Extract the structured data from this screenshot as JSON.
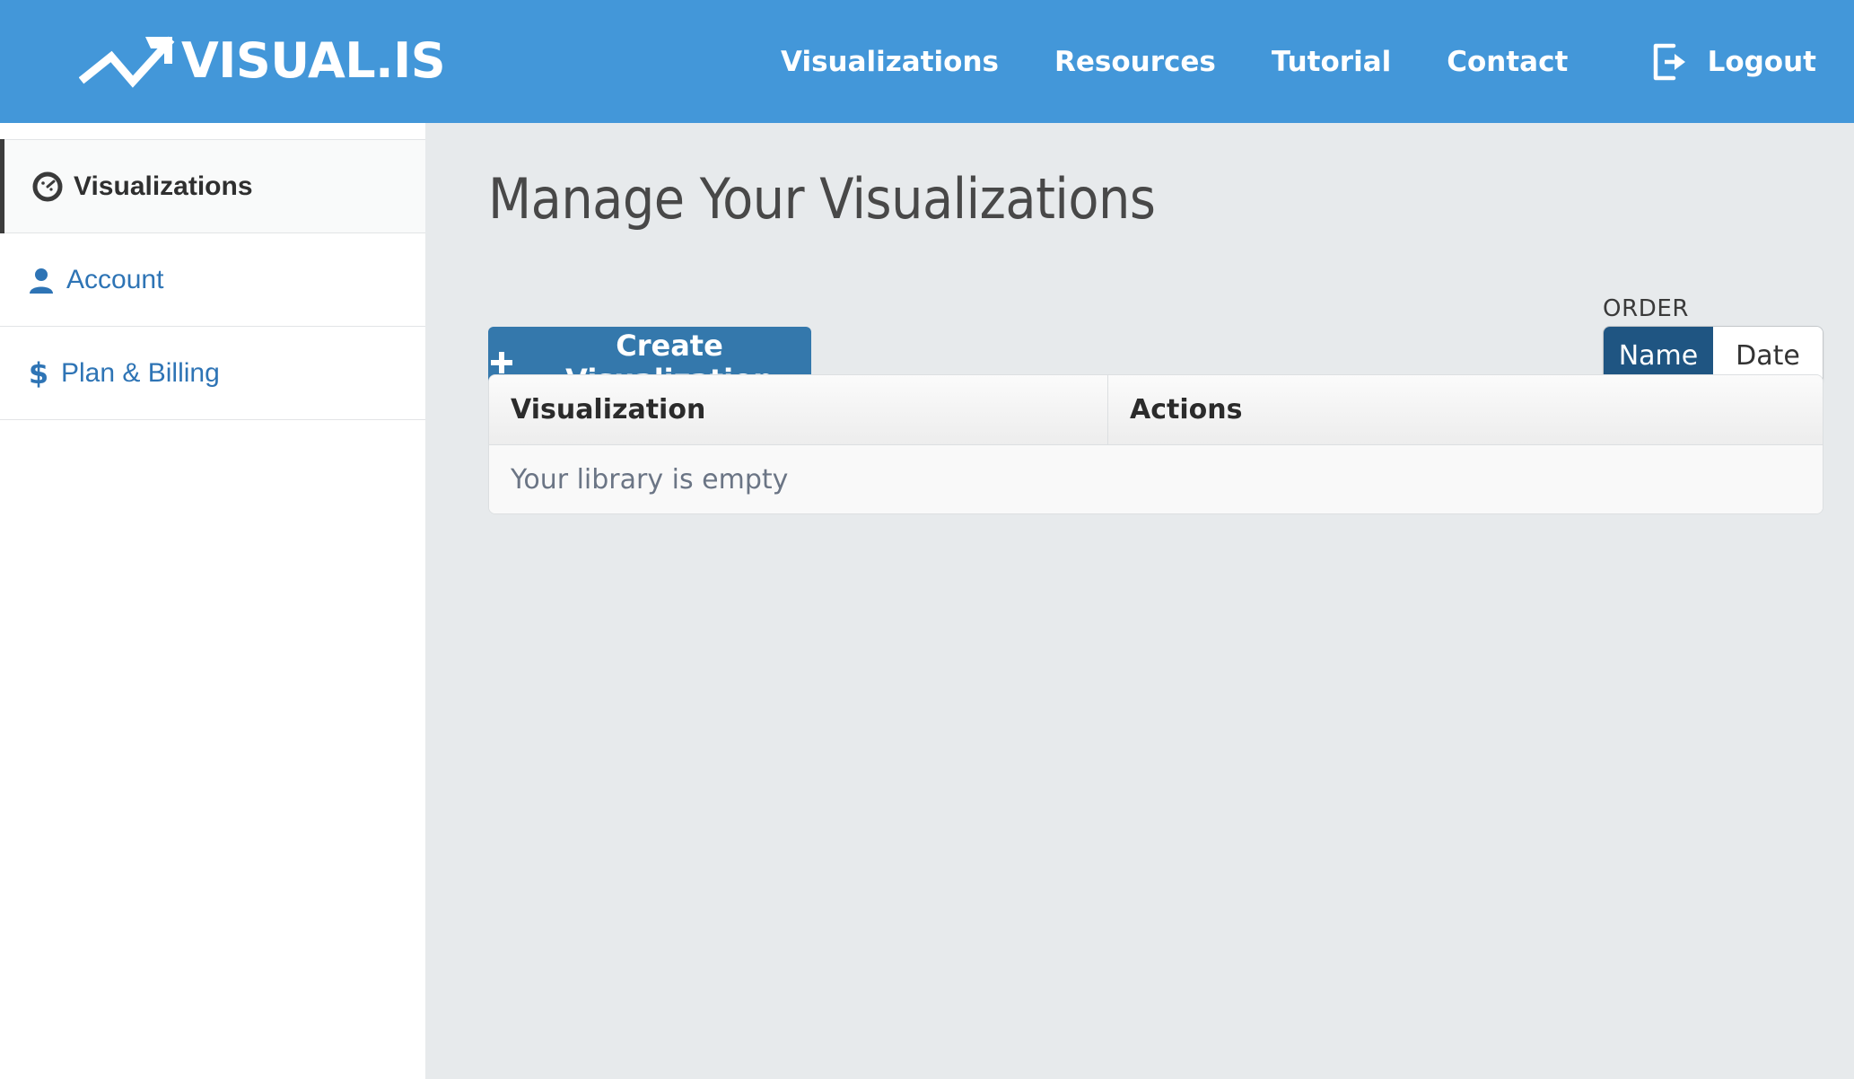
{
  "header": {
    "logo_text": "VISUAL.IS",
    "logo_icon": "line-chart-arrow-icon",
    "nav": [
      {
        "label": "Visualizations"
      },
      {
        "label": "Resources"
      },
      {
        "label": "Tutorial"
      },
      {
        "label": "Contact"
      }
    ],
    "logout": {
      "label": "Logout",
      "icon": "sign-out-icon"
    },
    "background_color": "#4397d9"
  },
  "sidebar": {
    "items": [
      {
        "label": "Visualizations",
        "icon": "dashboard-gauge-icon",
        "active": true
      },
      {
        "label": "Account",
        "icon": "user-icon",
        "active": false
      },
      {
        "label": "Plan & Billing",
        "icon": "dollar-sign-icon",
        "active": false
      }
    ],
    "link_color": "#2e74b5",
    "active_border_color": "#3c3c3c"
  },
  "main": {
    "title": "Manage Your Visualizations",
    "create_button": {
      "label": "Create Visualization",
      "icon": "plus-icon",
      "color": "#3478ac"
    },
    "order": {
      "label": "ORDER",
      "options": [
        {
          "label": "Name",
          "selected": true
        },
        {
          "label": "Date",
          "selected": false
        }
      ],
      "selected_color": "#1f5582"
    },
    "table": {
      "columns": [
        "Visualization",
        "Actions"
      ],
      "rows": [],
      "empty_message": "Your library is empty"
    }
  }
}
